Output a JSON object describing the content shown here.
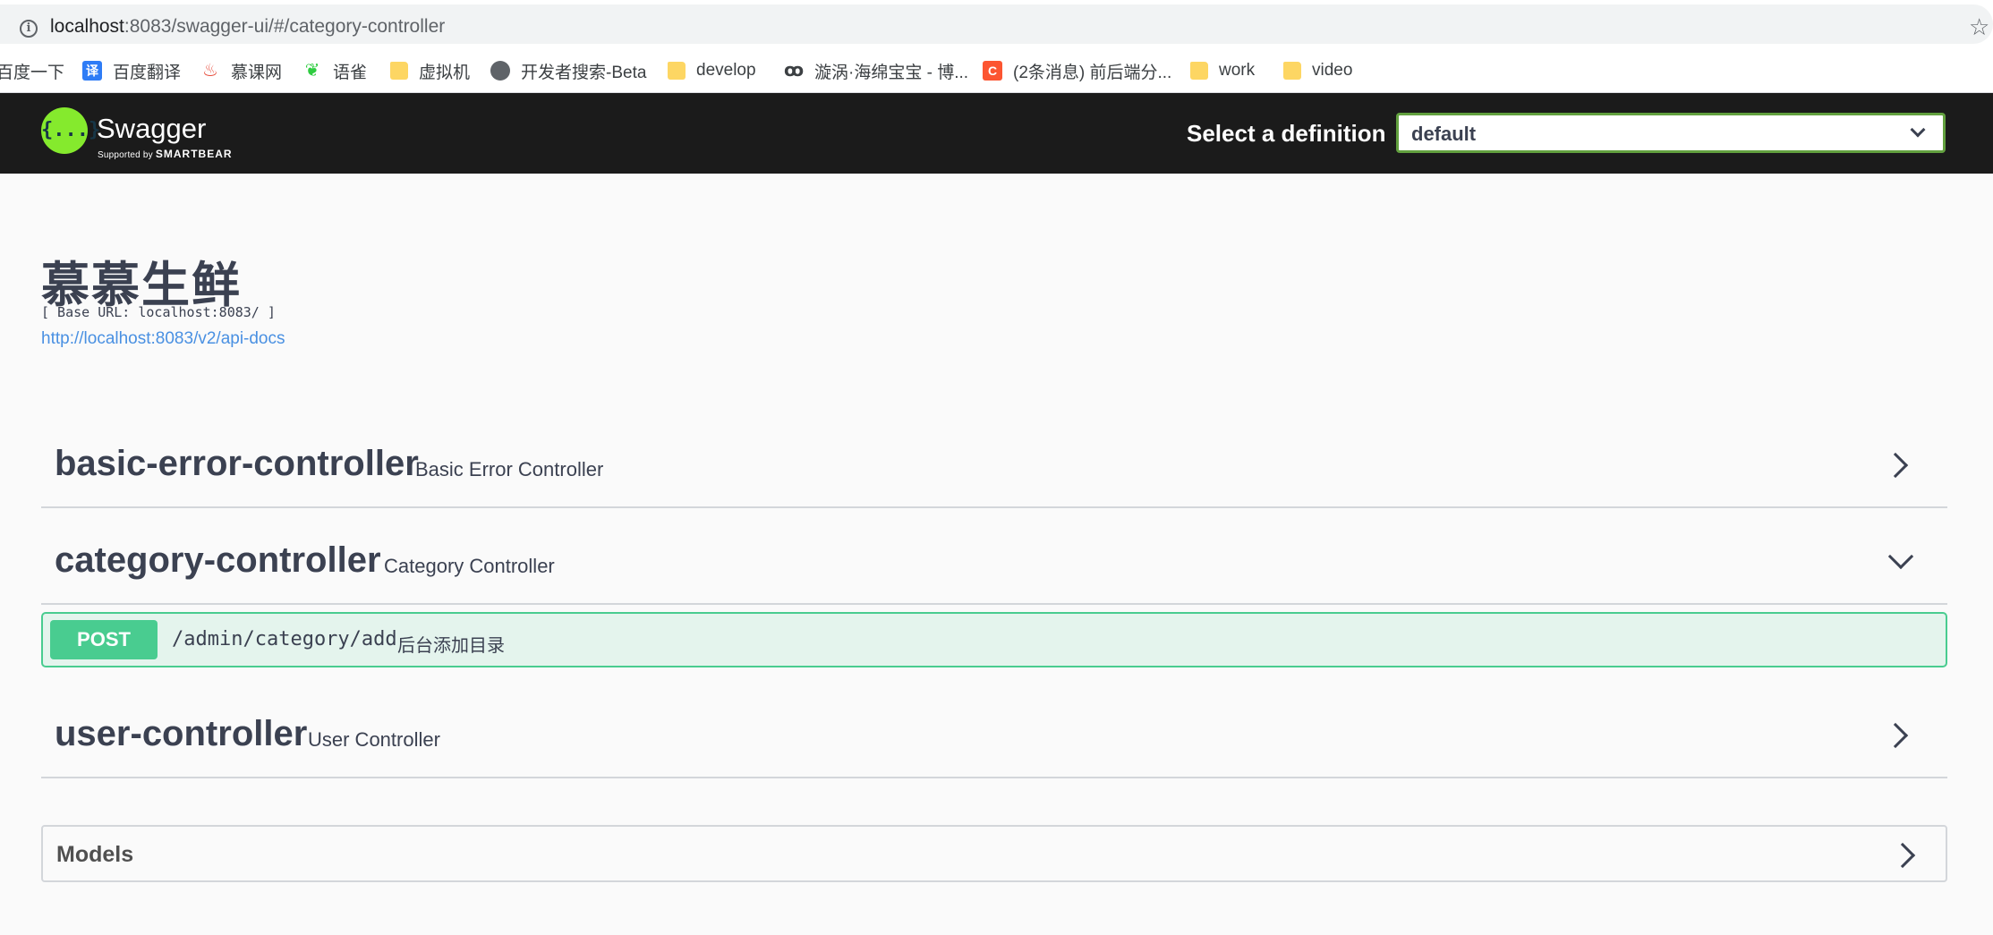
{
  "browser": {
    "url_host": "localhost",
    "url_rest": ":8083/swagger-ui/#/category-controller",
    "bookmarks": [
      {
        "label": "百度一下",
        "icon": "none"
      },
      {
        "label": "百度翻译",
        "icon": "fanyi-icon"
      },
      {
        "label": "慕课网",
        "icon": "fire-icon"
      },
      {
        "label": "语雀",
        "icon": "leaf-icon"
      },
      {
        "label": "虚拟机",
        "icon": "folder-icon"
      },
      {
        "label": "开发者搜索-Beta",
        "icon": "globe-icon"
      },
      {
        "label": "develop",
        "icon": "folder-icon"
      },
      {
        "label": "漩涡·海绵宝宝 - 博...",
        "icon": "swirl-icon"
      },
      {
        "label": "(2条消息) 前后端分...",
        "icon": "csdn-icon"
      },
      {
        "label": "work",
        "icon": "folder-icon"
      },
      {
        "label": "video",
        "icon": "folder-icon"
      }
    ]
  },
  "topbar": {
    "logo_name": "Swagger",
    "logo_mark": "{...}",
    "logo_sub_prefix": "Supported by",
    "logo_sub_brand": "SMARTBEAR",
    "select_label": "Select a definition",
    "select_value": "default"
  },
  "info": {
    "title": "慕慕生鲜",
    "base_url": "[ Base URL: localhost:8083/ ]",
    "spec_link": "http://localhost:8083/v2/api-docs"
  },
  "tags": [
    {
      "name": "basic-error-controller",
      "description": "Basic Error Controller",
      "expanded": false
    },
    {
      "name": "category-controller",
      "description": "Category Controller",
      "expanded": true
    },
    {
      "name": "user-controller",
      "description": "User Controller",
      "expanded": false
    }
  ],
  "operations": [
    {
      "method": "POST",
      "path": "/admin/category/add",
      "summary": "后台添加目录"
    }
  ],
  "models": {
    "title": "Models"
  },
  "colors": {
    "post": "#49cc90",
    "topbar_bg": "#1b1b1b",
    "logo_green": "#85ea2d",
    "link": "#4990e2"
  }
}
